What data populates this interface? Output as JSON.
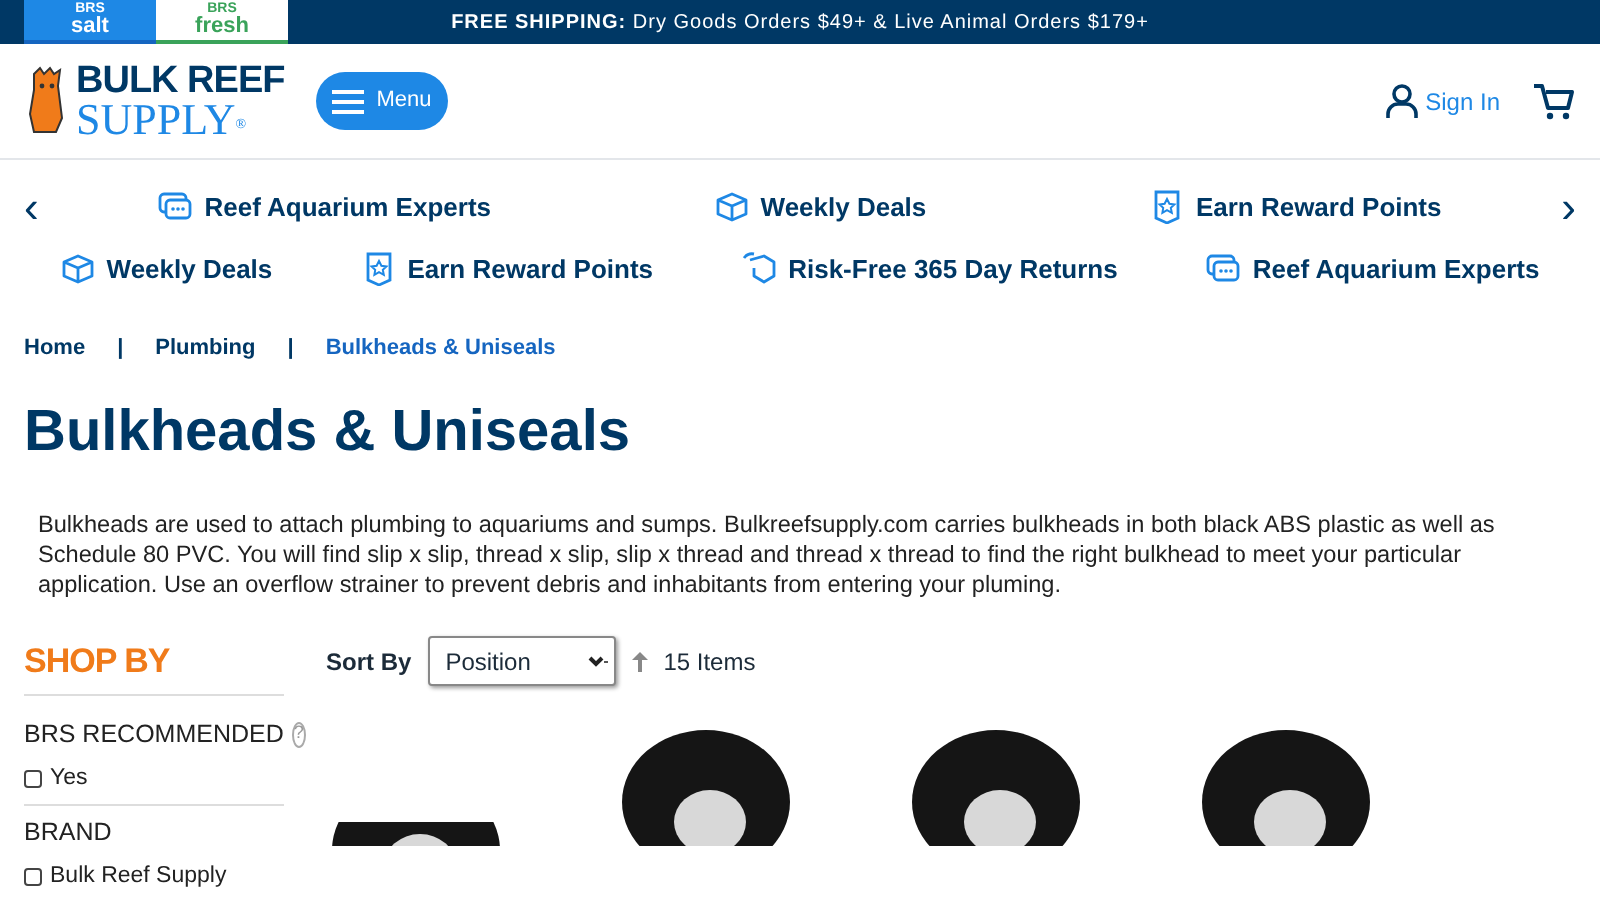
{
  "top_bar": {
    "store_tabs": [
      {
        "small": "BRS",
        "big": "salt",
        "selected": true
      },
      {
        "small": "BRS",
        "big": "fresh",
        "selected": false
      }
    ],
    "shipping": "**FREE SHIPPING:** Dry Goods Orders $49+ & Live Animal Orders $179+"
  },
  "header": {
    "logo": {
      "line1": "BULK REEF",
      "line2": "SUPPLY",
      "mark": "®"
    },
    "menu_button": "Menu",
    "sign_in": "Sign In"
  },
  "benefits_carousel": {
    "prev": "‹",
    "next": "›",
    "items": [
      {
        "kind": "chat",
        "label": "Reef Aquarium Experts"
      },
      {
        "kind": "box",
        "label": "Weekly Deals"
      },
      {
        "kind": "badge",
        "label": "Earn Reward Points"
      }
    ]
  },
  "benefits_strip": {
    "items": [
      {
        "kind": "box",
        "label": "Weekly Deals"
      },
      {
        "kind": "badge",
        "label": "Earn Reward Points"
      },
      {
        "kind": "return",
        "label": "Risk-Free 365 Day Returns"
      },
      {
        "kind": "chat",
        "label": "Reef Aquarium Experts"
      }
    ]
  },
  "breadcrumb": [
    {
      "label": "Home",
      "current": false
    },
    {
      "label": "Plumbing",
      "current": false
    },
    {
      "label": "Bulkheads & Uniseals",
      "current": true
    }
  ],
  "breadcrumb_separator": "|",
  "title": "Bulkheads & Uniseals",
  "description": "Bulkheads are used to attach plumbing to aquariums and sumps. Bulkreefsupply.com carries bulkheads in both black ABS plastic as well as Schedule 80 PVC. You will find slip x slip, thread x slip, slip x thread and thread x thread to find the right bulkhead to meet your particular application. Use an overflow strainer to prevent debris and inhabitants from entering your pluming.",
  "sidebar": {
    "heading": "SHOP BY",
    "filters": [
      {
        "title": "BRS RECOMMENDED",
        "help": "?",
        "options": [
          {
            "label": "Yes",
            "checked": false
          }
        ]
      },
      {
        "title": "BRAND",
        "options": [
          {
            "label": "Bulk Reef Supply",
            "checked": false
          }
        ]
      }
    ]
  },
  "toolbar": {
    "sort_label": "Sort By",
    "sort_value": "Position",
    "count": "15 Items"
  },
  "products": [
    {
      "kind": "ring"
    },
    {
      "kind": "ring"
    },
    {
      "kind": "ring"
    },
    {
      "kind": "ring"
    }
  ]
}
